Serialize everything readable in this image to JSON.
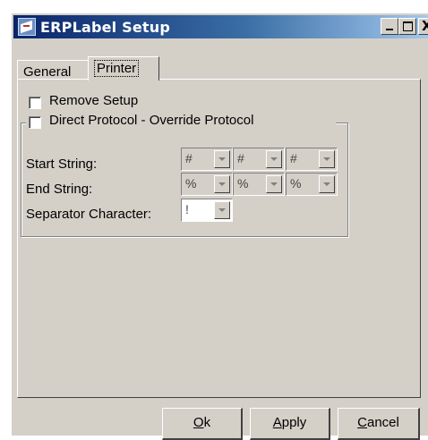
{
  "window": {
    "title": "ERPLabel Setup"
  },
  "title_buttons": {
    "minimize": "_",
    "maximize": "□",
    "close": "X"
  },
  "tabs": [
    {
      "label": "General",
      "active": false
    },
    {
      "label": "Printer",
      "active": true
    }
  ],
  "printer": {
    "remove_setup_label": "Remove Setup",
    "remove_setup_checked": false,
    "direct_protocol_label": "Direct Protocol - Override Protocol",
    "direct_protocol_checked": false,
    "start_string_label": "Start String:",
    "start_string_values": [
      "#",
      "#",
      "#"
    ],
    "end_string_label": "End String:",
    "end_string_values": [
      "%",
      "%",
      "%"
    ],
    "separator_label": "Separator Character:",
    "separator_value": "!"
  },
  "buttons": {
    "ok_mnemonic": "O",
    "ok_rest": "k",
    "apply_mnemonic": "A",
    "apply_rest": "pply",
    "cancel_mnemonic": "C",
    "cancel_rest": "ancel"
  },
  "icons": {
    "app": "erplabel-app-icon"
  }
}
